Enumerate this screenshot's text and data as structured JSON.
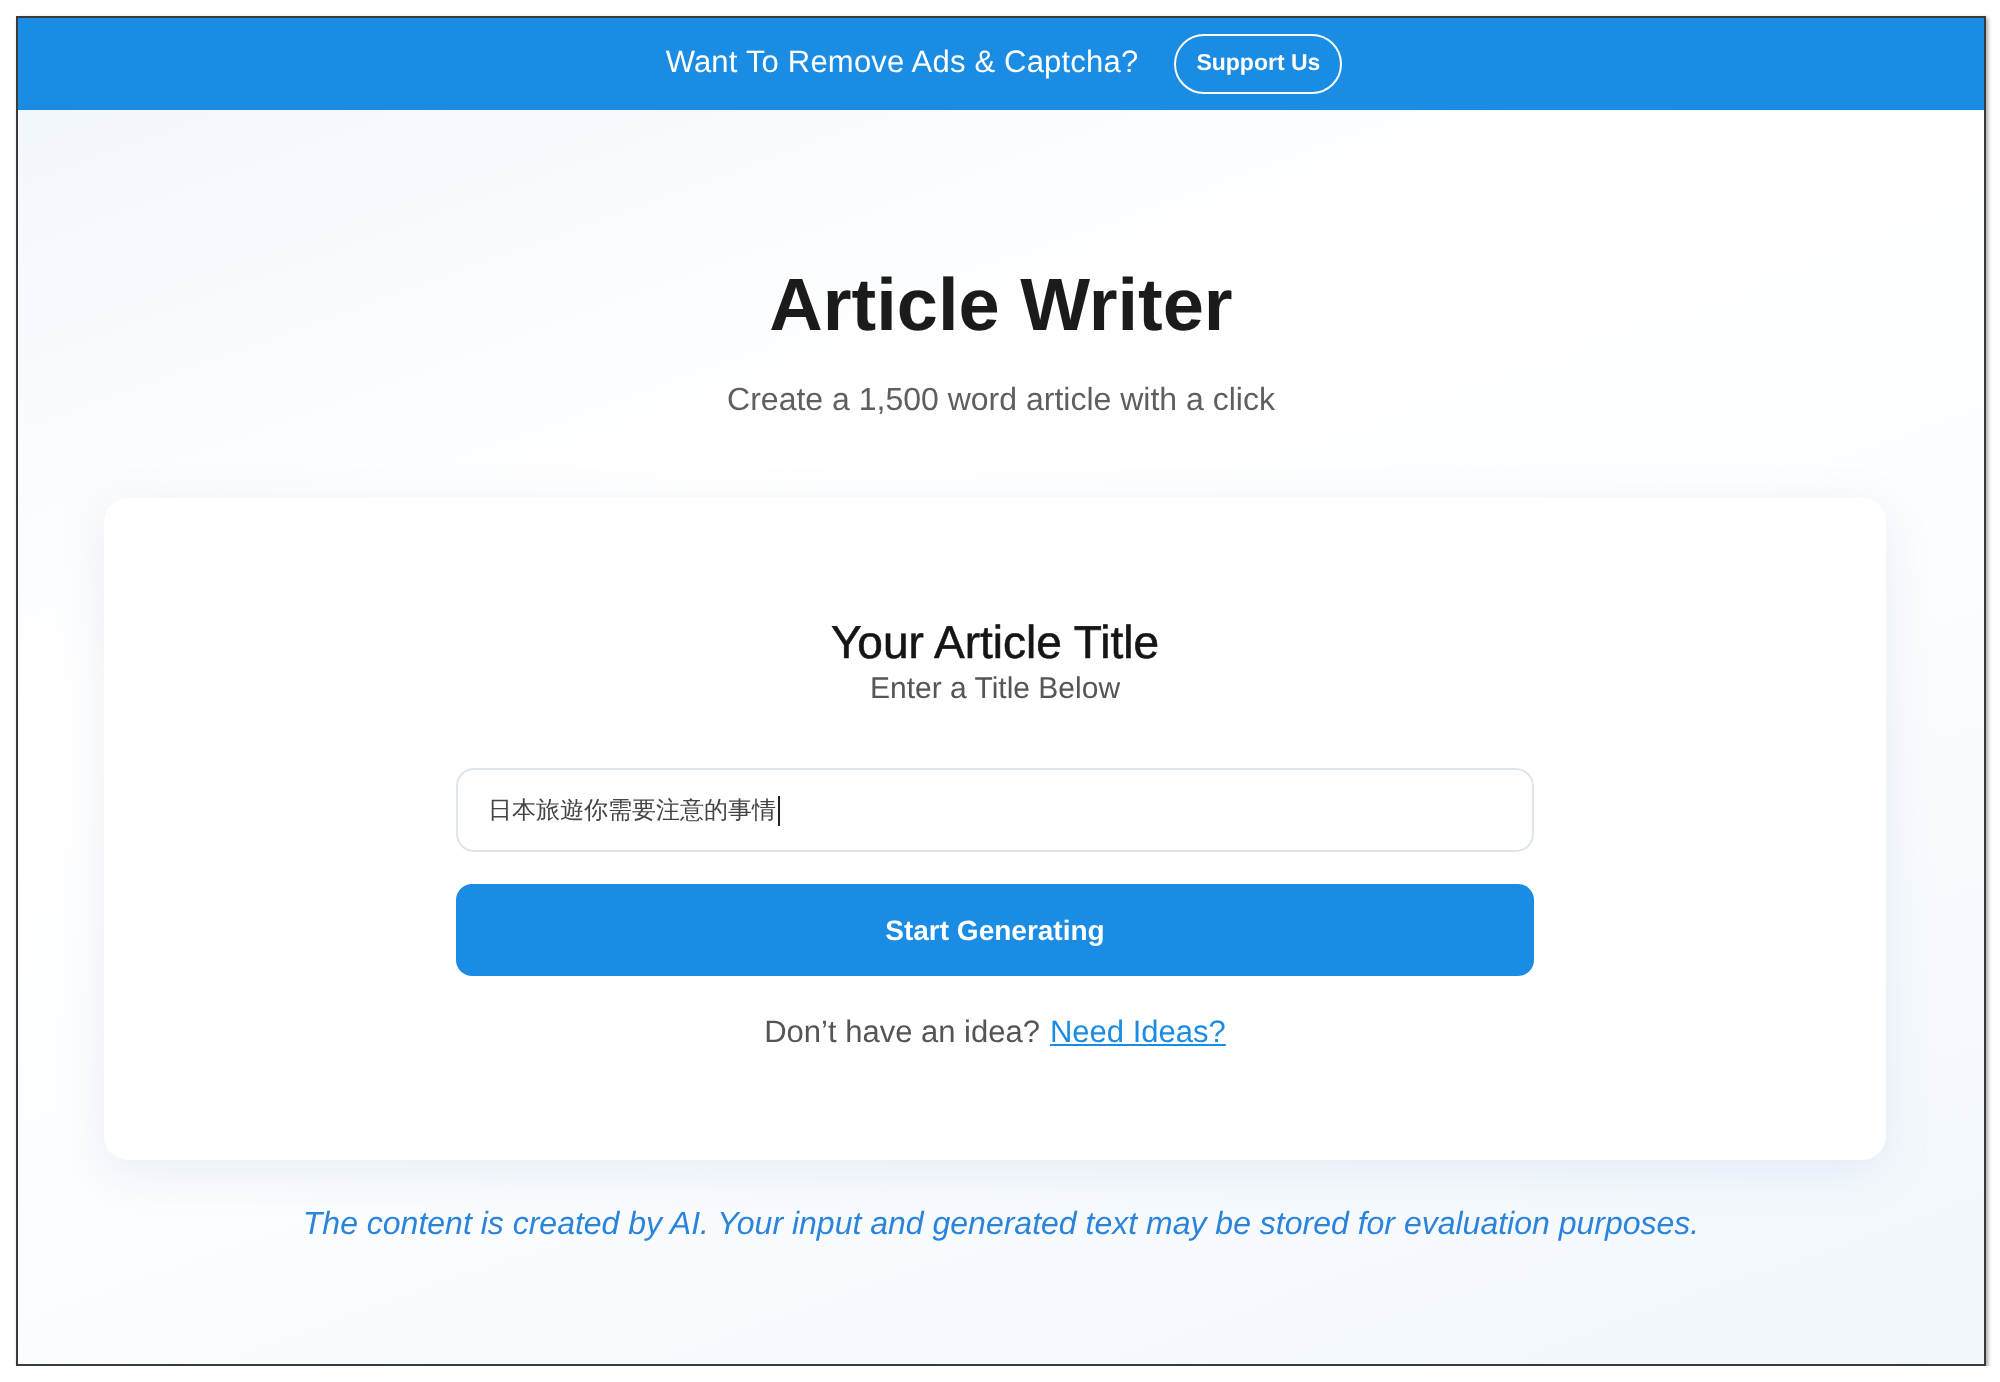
{
  "banner": {
    "text": "Want To Remove Ads & Captcha?",
    "button": "Support Us"
  },
  "header": {
    "title": "Article Writer",
    "subtitle": "Create a 1,500 word article with a click"
  },
  "form": {
    "heading": "Your Article Title",
    "subheading": "Enter a Title Below",
    "title_input": {
      "value": "日本旅遊你需要注意的事情",
      "focused": true
    },
    "submit_button": "Start Generating",
    "hint": "Don’t have an idea?",
    "hint_link": "Need Ideas?"
  },
  "disclaimer": "The content is created by AI. Your input and generated text may be stored for evaluation purposes."
}
